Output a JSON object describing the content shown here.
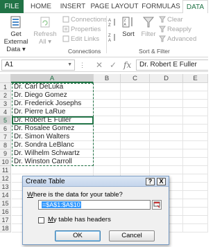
{
  "ribbon_tabs": [
    "FILE",
    "HOME",
    "INSERT",
    "PAGE LAYOUT",
    "FORMULAS",
    "DATA"
  ],
  "ribbon": {
    "get_external_1": "Get External",
    "get_external_2": "Data",
    "refresh_1": "Refresh",
    "refresh_2": "All",
    "connections": "Connections",
    "properties": "Properties",
    "edit_links": "Edit Links",
    "sort": "Sort",
    "filter": "Filter",
    "clear": "Clear",
    "reapply": "Reapply",
    "advanced": "Advanced",
    "group_connections": "Connections",
    "group_sort_filter": "Sort & Filter"
  },
  "formula_bar": {
    "name_box": "A1",
    "fx": "fx",
    "content": "Dr. Robert E Fuller"
  },
  "grid": {
    "columns": [
      "A",
      "B",
      "C",
      "D",
      "E"
    ],
    "rows": [
      "1",
      "2",
      "3",
      "4",
      "5",
      "6",
      "7",
      "8",
      "9",
      "10",
      "11",
      "12",
      "13",
      "14",
      "15",
      "16",
      "17",
      "18"
    ],
    "values": [
      "Dr. Carl DeLuka",
      "Dr. Diego Gomez",
      "Dr. Frederick Josephs",
      "Dr. Pierre LaRue",
      "Dr. Robert E Fuller",
      "Dr. Rosalee Gomez",
      "Dr. Simon Walters",
      "Dr. Sondra LeBlanc",
      "Dr. Wilhelm Schwartz",
      "Dr. Winston Carroll"
    ]
  },
  "dialog": {
    "title": "Create Table",
    "help": "?",
    "close": "X",
    "prompt": "Where is the data for your table?",
    "range": "=$A$1:$A$10",
    "checkbox_label": "My table has headers",
    "checkbox_checked": false,
    "ok": "OK",
    "cancel": "Cancel"
  },
  "colors": {
    "accent": "#217346",
    "dialog_title": "#c4d5ec"
  }
}
